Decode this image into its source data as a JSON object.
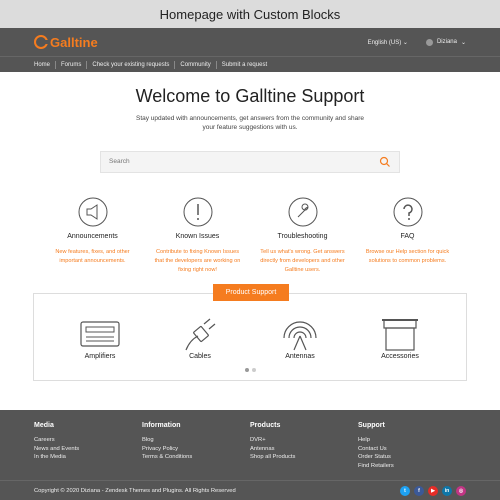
{
  "caption": "Homepage with Custom Blocks",
  "header": {
    "logo_text": "Galltine",
    "language": "English (US)",
    "language_caret": "⌄",
    "user_name": "Diziana",
    "user_caret": "⌄"
  },
  "nav": [
    "Home",
    "Forums",
    "Check your existing requests",
    "Community",
    "Submit a request"
  ],
  "hero": {
    "title": "Welcome to Galltine Support",
    "subtitle": "Stay updated with announcements, get answers from the community and share your feature suggestions with us."
  },
  "search": {
    "placeholder": "Search"
  },
  "categories": [
    {
      "title": "Announcements",
      "desc": "New features, fixes, and other important announcements."
    },
    {
      "title": "Known Issues",
      "desc": "Contribute to fixing Known Issues that the developers are working on fixing right now!"
    },
    {
      "title": "Troubleshooting",
      "desc": "Tell us what's wrong. Get answers directly from developers and other Galltine users."
    },
    {
      "title": "FAQ",
      "desc": "Browse our Help section for quick solutions to common problems."
    }
  ],
  "product_support": {
    "button": "Product Support",
    "items": [
      "Amplifiers",
      "Cables",
      "Antennas",
      "Accessories"
    ]
  },
  "footer": {
    "columns": [
      {
        "title": "Media",
        "links": [
          "Careers",
          "News and Events",
          "In the Media"
        ]
      },
      {
        "title": "Information",
        "links": [
          "Blog",
          "Privacy Policy",
          "Terms & Conditions"
        ]
      },
      {
        "title": "Products",
        "links": [
          "DVR+",
          "Antennas",
          "Shop all Products"
        ]
      },
      {
        "title": "Support",
        "links": [
          "Help",
          "Contact Us",
          "Order Status",
          "Find Retailers"
        ]
      }
    ],
    "copyright": "Copyright © 2020 Diziana - Zendesk Themes and Plugins. All Rights Reserved",
    "social": [
      {
        "name": "twitter-icon",
        "glyph": "t",
        "color": "#1da1f2"
      },
      {
        "name": "facebook-icon",
        "glyph": "f",
        "color": "#3b5998"
      },
      {
        "name": "youtube-icon",
        "glyph": "▶",
        "color": "#e52d27"
      },
      {
        "name": "linkedin-icon",
        "glyph": "in",
        "color": "#0e76a8"
      },
      {
        "name": "instagram-icon",
        "glyph": "◎",
        "color": "#c13584"
      }
    ]
  },
  "colors": {
    "accent": "#f57c1f",
    "header": "#555555"
  }
}
